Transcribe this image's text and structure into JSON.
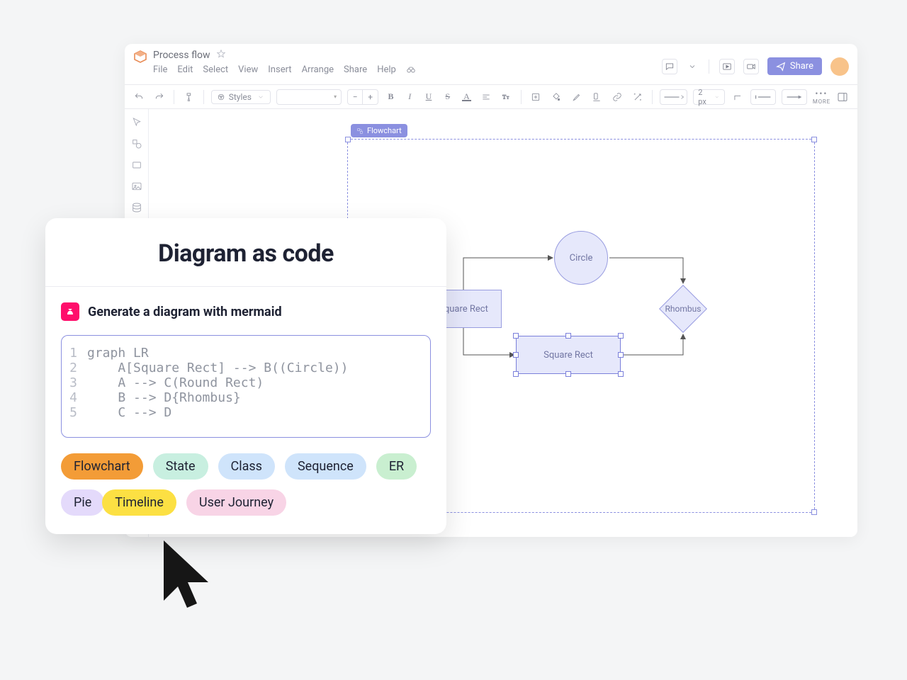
{
  "app": {
    "document_title": "Process flow",
    "menu": {
      "file": "File",
      "edit": "Edit",
      "select": "Select",
      "view": "View",
      "insert": "Insert",
      "arrange": "Arrange",
      "share": "Share",
      "help": "Help"
    },
    "share_button": "Share",
    "styles_dropdown": "Styles",
    "line_width": "2 px",
    "more_label": "MORE"
  },
  "canvas": {
    "selection_badge": "Flowchart",
    "nodes": {
      "square_rect_a": "Square Rect",
      "circle": "Circle",
      "square_rect_b": "Square Rect",
      "rhombus": "Rhombus"
    }
  },
  "dac": {
    "title": "Diagram as code",
    "subtitle": "Generate a diagram with mermaid",
    "code_lines": [
      "graph LR",
      "    A[Square Rect] --> B((Circle))",
      "    A --> C(Round Rect)",
      "    B --> D{Rhombus}",
      "    C --> D"
    ],
    "pills": {
      "flowchart": "Flowchart",
      "state": "State",
      "class": "Class",
      "sequence": "Sequence",
      "er": "ER",
      "pie": "Pie",
      "timeline": "Timeline",
      "user_journey": "User Journey"
    }
  }
}
